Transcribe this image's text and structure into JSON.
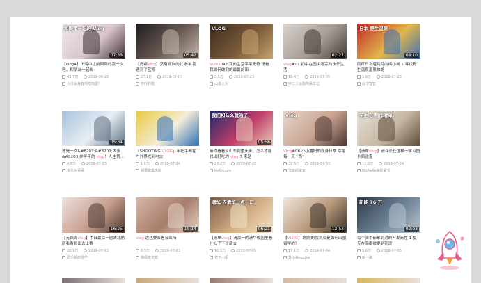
{
  "cards": [
    {
      "duration": "07:39",
      "title_pre": "【vlog4】上海中之前回到的我一次吧，和朋友一起去",
      "title_hl": "",
      "title_post": "",
      "views": "43.7万",
      "date": "2019-06-26",
      "uploader": "为什么先有鸡吃鸡蛋？",
      "colors": [
        "#f1e9ea",
        "#d8c4c9",
        "#3b2f33"
      ],
      "overlay": "和闺蜜一起的 Vlog"
    },
    {
      "duration": "05:42",
      "title_pre": "【元颖",
      "title_hl": "Vlog",
      "title_post": "】没有烦恼的北冰洋 我遇到了蓝鲸",
      "views": "27.1万",
      "date": "2019-07-03",
      "uploader": "不时秒酷",
      "colors": [
        "#1d1a1c",
        "#6b5c55",
        "#c9b9ad"
      ],
      "overlay": ""
    },
    {
      "duration": "",
      "title_pre": "",
      "title_hl": "VLOG",
      "title_post": "042 我的生活平平无奇 请看我如何做到的最最前面",
      "views": "3.5万",
      "date": "2019-07-23",
      "uploader": "山本大久",
      "colors": [
        "#3a2a1d",
        "#7a5a3a",
        "#c8a46f"
      ],
      "overlay": "VLOG"
    },
    {
      "duration": "02:27",
      "title_pre": "",
      "title_hl": "vlog",
      "title_post": "#01 初中在国中考完的快乐生活",
      "views": "16.4万",
      "date": "2019-07-05",
      "uploader": "中二少女陈阿呆日记",
      "colors": [
        "#d8d2cd",
        "#a79c95",
        "#3f3733"
      ],
      "overlay": ""
    },
    {
      "duration": "04:10",
      "title_pre": "同红日本遭到月内梅小城 1 寻找野生温泉温泉旅游",
      "title_hl": "",
      "title_post": "",
      "views": "1.9万",
      "date": "2019-07-25",
      "uploader": "山下智智",
      "colors": [
        "#c72a2a",
        "#e0b84a",
        "#3d6db8"
      ],
      "overlay": "日本 野生温泉"
    },
    {
      "duration": "05:34",
      "title_pre": "这是一次&#8203;&#8203;大多&#8203;奔平平的 ",
      "title_hl": "vlog",
      "title_post": "！人生第一次海边之旅",
      "views": "4.5万",
      "date": "2019-07-23",
      "uploader": "金东大哥哥",
      "colors": [
        "#a9c3dc",
        "#e8eef4",
        "#5c6f80"
      ],
      "overlay": ""
    },
    {
      "duration": "",
      "title_pre": "「SHOOTING ",
      "title_hl": "VLOG",
      "title_post": "」年把手都在户外界找到电大",
      "views": "1.5万",
      "date": "2019-07-24",
      "uploader": "我要做黑天鹅",
      "colors": [
        "#e9c93e",
        "#f4ecd6",
        "#2d6fb6"
      ],
      "overlay": ""
    },
    {
      "duration": "05:56",
      "title_pre": "带你看看从山东到重庆来，怎么才能找出好吃的 ",
      "title_hl": "vlog",
      "title_post": " 7 来是",
      "views": "23.2万",
      "date": "2019-07-22",
      "uploader": "bo结more",
      "colors": [
        "#1b2a6b",
        "#c23d6a",
        "#e9cbb6"
      ],
      "overlay": "我们和么么就活了"
    },
    {
      "duration": "",
      "title_pre": "",
      "title_hl": "Vlog",
      "title_post": "#06 小小撸妈的现身日常 幸福每一天 *西*",
      "views": "32.6万",
      "date": "2019-07-03",
      "uploader": "李媛的家家",
      "colors": [
        "#e8d7ce",
        "#c9a390",
        "#4b3430"
      ],
      "overlay": "Vlog"
    },
    {
      "duration": "",
      "title_pre": "【清单",
      "title_hl": "vlog",
      "title_post": "】请斗长任这样一学习图卡后途漫",
      "views": "11.2万",
      "date": "2019-07-24",
      "uploader": "Michelle梅影夏宝",
      "colors": [
        "#e9e2d8",
        "#c5b7a4",
        "#5e4b3a"
      ],
      "overlay": "学生吃 制作清单"
    },
    {
      "duration": "16:25",
      "title_pre": "【元颖周",
      "title_hl": "vlog",
      "title_post": "】中日最后一届去北航所看看和出去上赛",
      "views": "28.1万",
      "date": "2019-07-23",
      "uploader": "肥乐颖的雪兰",
      "colors": [
        "#ece2dc",
        "#c89d8d",
        "#4a3731"
      ],
      "overlay": ""
    },
    {
      "duration": "19:14",
      "title_pre": "",
      "title_hl": "vlog",
      "title_post": " 这也要去看会出吗",
      "views": "8.5万",
      "date": "2019-07-23",
      "uploader": "佛佩花花花",
      "colors": [
        "#d9b8a8",
        "#a67c6a",
        "#e6d3c8"
      ],
      "overlay": ""
    },
    {
      "duration": "06:21",
      "title_pre": "【清单",
      "title_hl": "vlog",
      "title_post": "】清晨一的清华校园里看什么了下班后去",
      "views": "78.5万",
      "date": "2019-07-05",
      "uploader": "若下小姐",
      "colors": [
        "#7b5a4a",
        "#d3ad82",
        "#f3e3c9"
      ],
      "overlay": "清华 去清华一点一口"
    },
    {
      "duration": "12:52",
      "title_pre": "【",
      "title_hl": "VLOG",
      "title_post": "】 刚刚的我到底是如何出国留学的？",
      "views": "17.1万",
      "date": "2019-07-04",
      "uploader": "苏小美sophie",
      "colors": [
        "#f0e6dc",
        "#b8987a",
        "#38302a"
      ],
      "overlay": ""
    },
    {
      "duration": "02:03",
      "title_pre": "每个骑手都都到对的开发商性 1 夏天在海南被要到到现",
      "title_hl": "",
      "title_post": "",
      "views": "5.6万",
      "date": "2019-07-05",
      "uploader": "新一路",
      "colors": [
        "#2e3b4a",
        "#6e8396",
        "#b7c4cf"
      ],
      "overlay": "新能 76 万"
    }
  ],
  "peek_colors": [
    "#7a6f73",
    "#c7a87a",
    "#9a7a70",
    "#d2b9a2",
    "#d9b65c"
  ],
  "icons": {
    "views": "play-icon",
    "date": "clock-icon",
    "uploader": "up-icon"
  },
  "accent": "#fb7299"
}
